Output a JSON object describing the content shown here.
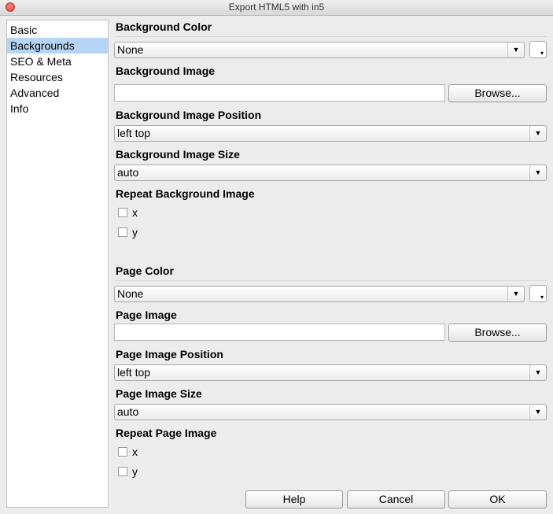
{
  "window": {
    "title": "Export HTML5 with in5"
  },
  "sidebar": {
    "items": [
      {
        "label": "Basic"
      },
      {
        "label": "Backgrounds"
      },
      {
        "label": "SEO & Meta"
      },
      {
        "label": "Resources"
      },
      {
        "label": "Advanced"
      },
      {
        "label": "Info"
      }
    ],
    "selected": "Backgrounds"
  },
  "background": {
    "color_label": "Background Color",
    "color_value": "None",
    "image_label": "Background Image",
    "image_value": "",
    "browse_label": "Browse...",
    "position_label": "Background Image Position",
    "position_value": "left top",
    "size_label": "Background Image Size",
    "size_value": "auto",
    "repeat_label": "Repeat Background Image",
    "repeat_x": "x",
    "repeat_y": "y"
  },
  "page": {
    "color_label": "Page Color",
    "color_value": "None",
    "image_label": "Page Image",
    "image_value": "",
    "browse_label": "Browse...",
    "position_label": "Page Image Position",
    "position_value": "left top",
    "size_label": "Page Image Size",
    "size_value": "auto",
    "repeat_label": "Repeat Page Image",
    "repeat_x": "x",
    "repeat_y": "y"
  },
  "footer": {
    "help_label": "Help",
    "cancel_label": "Cancel",
    "ok_label": "OK"
  }
}
